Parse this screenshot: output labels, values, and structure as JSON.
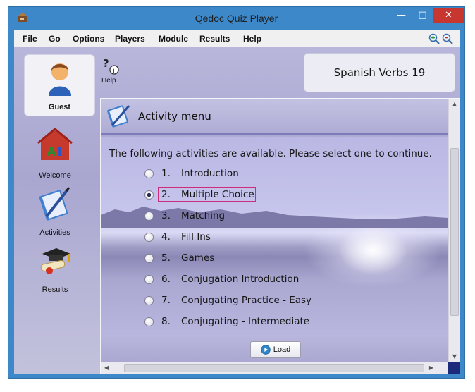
{
  "window": {
    "title": "Qedoc Quiz Player"
  },
  "menubar": {
    "items": [
      "File",
      "Go",
      "Options",
      "Players",
      "Module",
      "Results",
      "Help"
    ]
  },
  "sidebar": {
    "user": {
      "label": "Guest",
      "icon": "user-icon"
    },
    "items": [
      {
        "label": "Welcome",
        "icon": "welcome-icon"
      },
      {
        "label": "Activities",
        "icon": "activities-icon"
      },
      {
        "label": "Results",
        "icon": "results-icon"
      }
    ]
  },
  "toolbar": {
    "help_label": "Help"
  },
  "module": {
    "title": "Spanish Verbs 19"
  },
  "activity_menu": {
    "title": "Activity menu",
    "instruction": "The following activities are available. Please select one to continue.",
    "selected_index": 1,
    "options": [
      {
        "num": "1.",
        "label": "Introduction"
      },
      {
        "num": "2.",
        "label": "Multiple Choice"
      },
      {
        "num": "3.",
        "label": "Matching"
      },
      {
        "num": "4.",
        "label": "Fill Ins"
      },
      {
        "num": "5.",
        "label": "Games"
      },
      {
        "num": "6.",
        "label": "Conjugation Introduction"
      },
      {
        "num": "7.",
        "label": "Conjugating Practice - Easy"
      },
      {
        "num": "8.",
        "label": "Conjugating - Intermediate"
      }
    ],
    "load_label": "Load"
  },
  "colors": {
    "close_button": "#c7372f",
    "focus_border": "#d02a7a",
    "window_border": "#3c88c9"
  }
}
